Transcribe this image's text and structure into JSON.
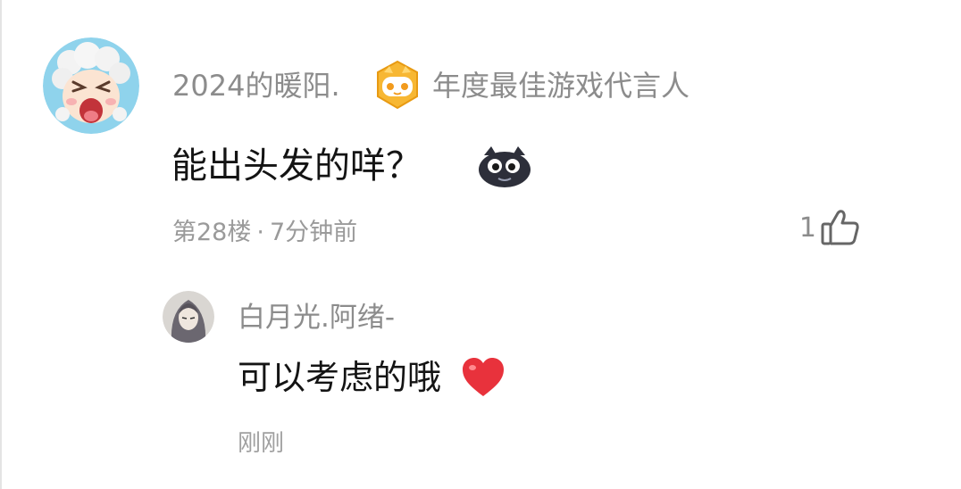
{
  "comment": {
    "username": "2024的暖阳.",
    "badge": {
      "icon": "game-controller-badge-icon",
      "title": "年度最佳游戏代言人",
      "color": "#f5a623"
    },
    "text": "能出头发的咩？",
    "emoji": "black-cat-emoji-icon",
    "floor": "第28楼",
    "separator": "·",
    "time": "7分钟前",
    "like_count": "1",
    "like_icon": "thumbs-up-icon"
  },
  "reply": {
    "username": "白月光.阿绪-",
    "text": "可以考虑的哦",
    "emoji": "red-heart-emoji-icon",
    "time": "刚刚"
  },
  "colors": {
    "primary_text": "#141414",
    "secondary_text": "#8c8c8c",
    "heart": "#e8323c"
  }
}
